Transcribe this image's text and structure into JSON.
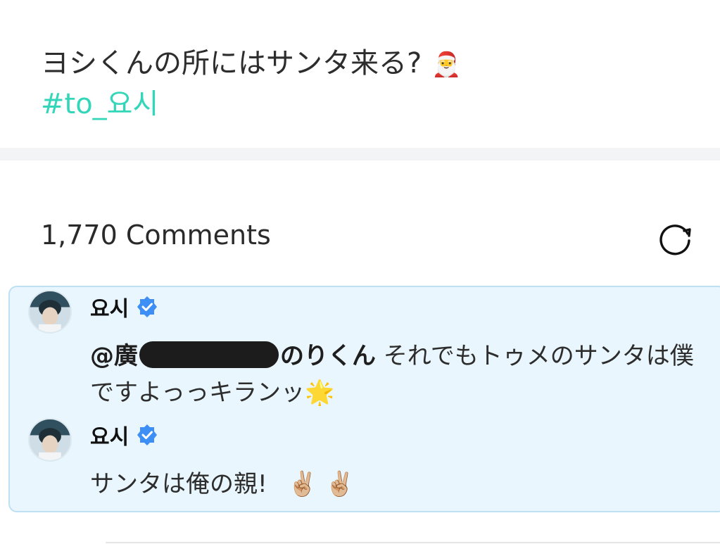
{
  "post": {
    "text": "ヨシくんの所にはサンタ来る?",
    "text_emoji": "🎅",
    "hashtag": "#to_요시"
  },
  "comments_section": {
    "count_label": "1,770 Comments",
    "refresh_icon": "refresh-icon"
  },
  "thread": [
    {
      "author": "요시",
      "verified": true,
      "mention_prefix": "@廣",
      "mention_suffix": "のりくん",
      "text": " それでもトゥメのサンタは僕ですよっっキランッ",
      "emoji": "🌟"
    },
    {
      "author": "요시",
      "verified": true,
      "text": "サンタは俺の親!",
      "emoji": "✌🏼 ✌🏼"
    }
  ],
  "colors": {
    "hashtag": "#33d6b8",
    "verified": "#3d8ef5",
    "thread_bg": "#e9f6fd",
    "thread_border": "#bde0f2"
  }
}
